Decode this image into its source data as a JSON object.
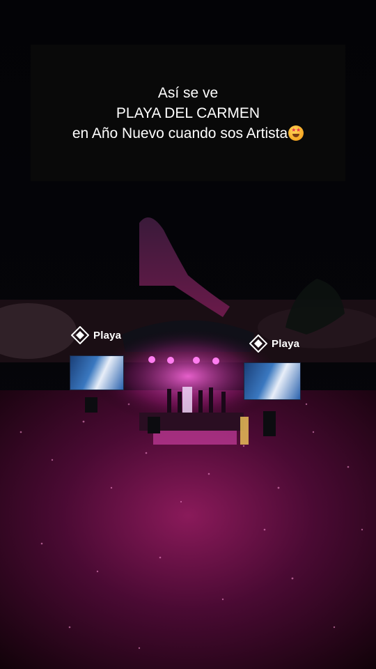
{
  "caption": {
    "line1": "Así se ve",
    "line2": "PLAYA DEL CARMEN",
    "line3": "en Año Nuevo cuando sos Artista"
  },
  "stage": {
    "logo_left_text": "Playa",
    "logo_right_text": "Playa"
  },
  "colors": {
    "background": "#000000",
    "stage_light": "#ff3fd0",
    "crowd_glow": "#c0246a",
    "screen_blue": "#1f5fb0"
  }
}
